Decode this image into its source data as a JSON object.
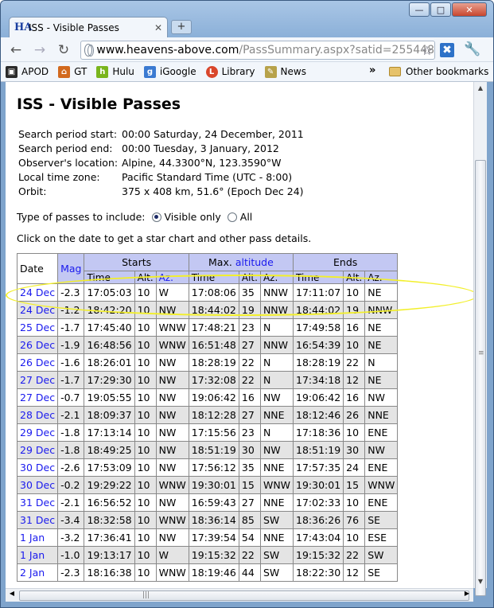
{
  "browser": {
    "tab_title": "ISS - Visible Passes",
    "tab_favicon": "HA",
    "url_host": "www.heavens-above.com",
    "url_path": "/PassSummary.aspx?satid=255448",
    "bookmarks": [
      {
        "label": "APOD",
        "icon": "apod-icon",
        "color": "#2a2a2a"
      },
      {
        "label": "GT",
        "icon": "gt-icon",
        "color": "#d2691e"
      },
      {
        "label": "Hulu",
        "icon": "hulu-icon",
        "color": "#7ab51d"
      },
      {
        "label": "iGoogle",
        "icon": "igoogle-icon",
        "color": "#3b7ad1"
      },
      {
        "label": "Library",
        "icon": "library-icon",
        "color": "#d9462b"
      },
      {
        "label": "News",
        "icon": "news-icon",
        "color": "#b7a24a"
      }
    ],
    "more": "»",
    "other_bookmarks": "Other bookmarks"
  },
  "page": {
    "title": "ISS - Visible Passes",
    "info": [
      {
        "label": "Search period start:",
        "value": "00:00 Saturday, 24 December, 2011"
      },
      {
        "label": "Search period end:",
        "value": "00:00 Tuesday, 3 January, 2012"
      },
      {
        "label": "Observer's location:",
        "value": "Alpine, 44.3300°N, 123.3590°W"
      },
      {
        "label": "Local time zone:",
        "value": "Pacific Standard Time (UTC - 8:00)"
      },
      {
        "label": "Orbit:",
        "value": "375 x 408 km, 51.6° (Epoch Dec 24)"
      }
    ],
    "type_label": "Type of passes to include:",
    "option_visible": "Visible only",
    "option_all": "All",
    "click_note": "Click on the date to get a star chart and other pass details."
  },
  "table": {
    "h_date": "Date",
    "h_mag": "Mag",
    "h_starts": "Starts",
    "h_max_prefix": "Max.",
    "h_max_link": "altitude",
    "h_ends": "Ends",
    "h_time": "Time",
    "h_alt": "Alt.",
    "h_az": "Az.",
    "rows": [
      [
        "24 Dec",
        "-2.3",
        "17:05:03",
        "10",
        "W",
        "17:08:06",
        "35",
        "NNW",
        "17:11:07",
        "10",
        "NE"
      ],
      [
        "24 Dec",
        "-1.2",
        "18:42:20",
        "10",
        "NW",
        "18:44:02",
        "19",
        "NNW",
        "18:44:02",
        "19",
        "NNW"
      ],
      [
        "25 Dec",
        "-1.7",
        "17:45:40",
        "10",
        "WNW",
        "17:48:21",
        "23",
        "N",
        "17:49:58",
        "16",
        "NE"
      ],
      [
        "26 Dec",
        "-1.9",
        "16:48:56",
        "10",
        "WNW",
        "16:51:48",
        "27",
        "NNW",
        "16:54:39",
        "10",
        "NE"
      ],
      [
        "26 Dec",
        "-1.6",
        "18:26:01",
        "10",
        "NW",
        "18:28:19",
        "22",
        "N",
        "18:28:19",
        "22",
        "N"
      ],
      [
        "27 Dec",
        "-1.7",
        "17:29:30",
        "10",
        "NW",
        "17:32:08",
        "22",
        "N",
        "17:34:18",
        "12",
        "NE"
      ],
      [
        "27 Dec",
        "-0.7",
        "19:05:55",
        "10",
        "NW",
        "19:06:42",
        "16",
        "NW",
        "19:06:42",
        "16",
        "NW"
      ],
      [
        "28 Dec",
        "-2.1",
        "18:09:37",
        "10",
        "NW",
        "18:12:28",
        "27",
        "NNE",
        "18:12:46",
        "26",
        "NNE"
      ],
      [
        "29 Dec",
        "-1.8",
        "17:13:14",
        "10",
        "NW",
        "17:15:56",
        "23",
        "N",
        "17:18:36",
        "10",
        "ENE"
      ],
      [
        "29 Dec",
        "-1.8",
        "18:49:25",
        "10",
        "NW",
        "18:51:19",
        "30",
        "NW",
        "18:51:19",
        "30",
        "NW"
      ],
      [
        "30 Dec",
        "-2.6",
        "17:53:09",
        "10",
        "NW",
        "17:56:12",
        "35",
        "NNE",
        "17:57:35",
        "24",
        "ENE"
      ],
      [
        "30 Dec",
        "-0.2",
        "19:29:22",
        "10",
        "WNW",
        "19:30:01",
        "15",
        "WNW",
        "19:30:01",
        "15",
        "WNW"
      ],
      [
        "31 Dec",
        "-2.1",
        "16:56:52",
        "10",
        "NW",
        "16:59:43",
        "27",
        "NNE",
        "17:02:33",
        "10",
        "ENE"
      ],
      [
        "31 Dec",
        "-3.4",
        "18:32:58",
        "10",
        "WNW",
        "18:36:14",
        "85",
        "SW",
        "18:36:26",
        "76",
        "SE"
      ],
      [
        "1 Jan",
        "-3.2",
        "17:36:41",
        "10",
        "NW",
        "17:39:54",
        "54",
        "NNE",
        "17:43:04",
        "10",
        "ESE"
      ],
      [
        "1 Jan",
        "-1.0",
        "19:13:17",
        "10",
        "W",
        "19:15:32",
        "22",
        "SW",
        "19:15:32",
        "22",
        "SW"
      ],
      [
        "2 Jan",
        "-2.3",
        "18:16:38",
        "10",
        "WNW",
        "18:19:46",
        "44",
        "SW",
        "18:22:30",
        "12",
        "SE"
      ]
    ]
  }
}
